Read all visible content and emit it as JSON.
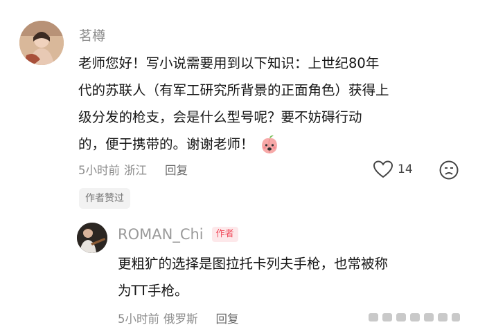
{
  "comment": {
    "username": "茗樽",
    "lines": [
      "老师您好！写小说需要用到以下知识：上世纪80年",
      "代的苏联人（有军工研究所背景的正面角色）获得上",
      "级分发的枪支，会是什么型号呢？要不妨碍行动",
      "的，便于携带的。谢谢老师！"
    ],
    "time": "5小时前",
    "location": "浙江",
    "reply_label": "回复",
    "like_count": "14",
    "author_liked_tag": "作者赞过"
  },
  "reply": {
    "username": "ROMAN_Chi",
    "author_badge": "作者",
    "lines": [
      "更粗犷的选择是图拉托卡列夫手枪，也常被称",
      "为TT手枪。"
    ],
    "time": "5小时前",
    "location": "俄罗斯",
    "reply_label": "回复"
  },
  "icons": {
    "like": "heart-outline-icon",
    "dislike": "sad-face-icon",
    "emoji": "peach-emoji-icon"
  },
  "colors": {
    "author_badge_text": "#f04a5a",
    "author_badge_bg": "#fde8ea",
    "meta_text": "#8c8c8c"
  }
}
